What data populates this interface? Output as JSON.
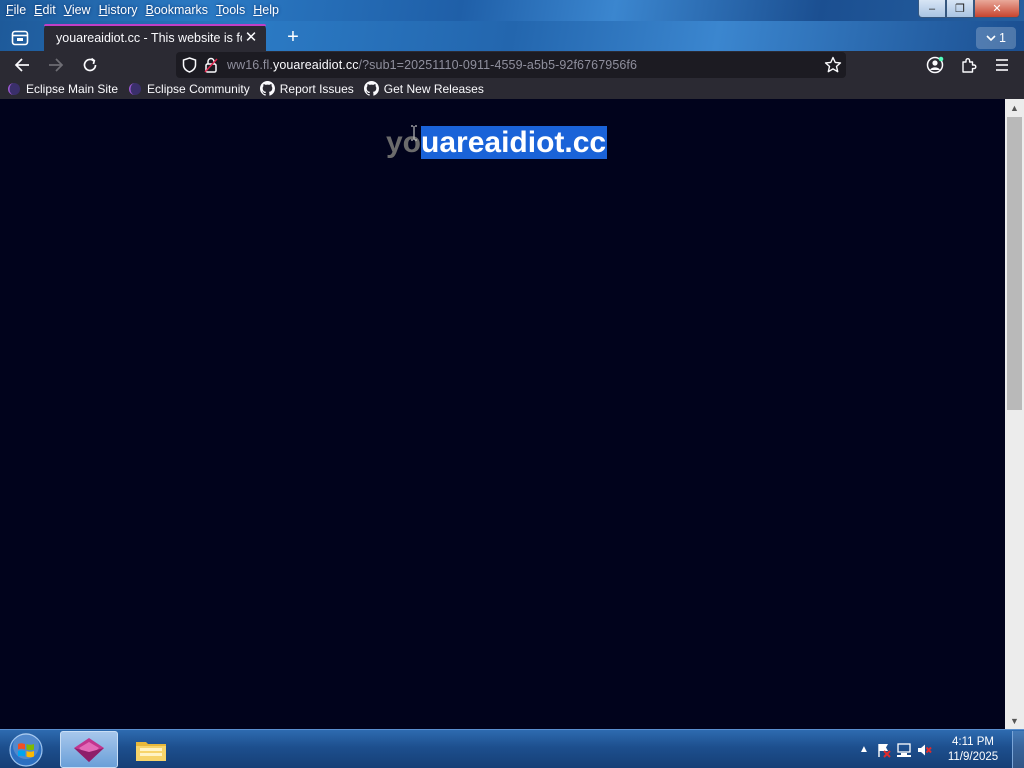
{
  "menu": [
    "File",
    "Edit",
    "View",
    "History",
    "Bookmarks",
    "Tools",
    "Help"
  ],
  "window_controls": {
    "minimize": "–",
    "restore": "❐",
    "close": "✕"
  },
  "tab": {
    "title": "youareaidiot.cc - This website is for",
    "close": "✕"
  },
  "new_tab_label": "+",
  "tab_count": "1",
  "url": {
    "prefix": "ww16.fl.",
    "domain": "youareaidiot.cc",
    "path": "/?sub1=20251110-0911-4559-a5b5-92f6767956f6"
  },
  "bookmarks": [
    {
      "label": "Eclipse Main Site",
      "icon": "eclipse-icon"
    },
    {
      "label": "Eclipse Community",
      "icon": "eclipse-icon"
    },
    {
      "label": "Report Issues",
      "icon": "github-icon"
    },
    {
      "label": "Get New Releases",
      "icon": "github-icon"
    }
  ],
  "page": {
    "heading_plain": "yo",
    "heading_selected": "uareaidiot.cc"
  },
  "clock": {
    "time": "4:11 PM",
    "date": "11/9/2025"
  },
  "colors": {
    "accent": "#c13fc6",
    "selection": "#1a63d8",
    "page_bg": "#01031c",
    "toolbar": "#2b2a33"
  }
}
